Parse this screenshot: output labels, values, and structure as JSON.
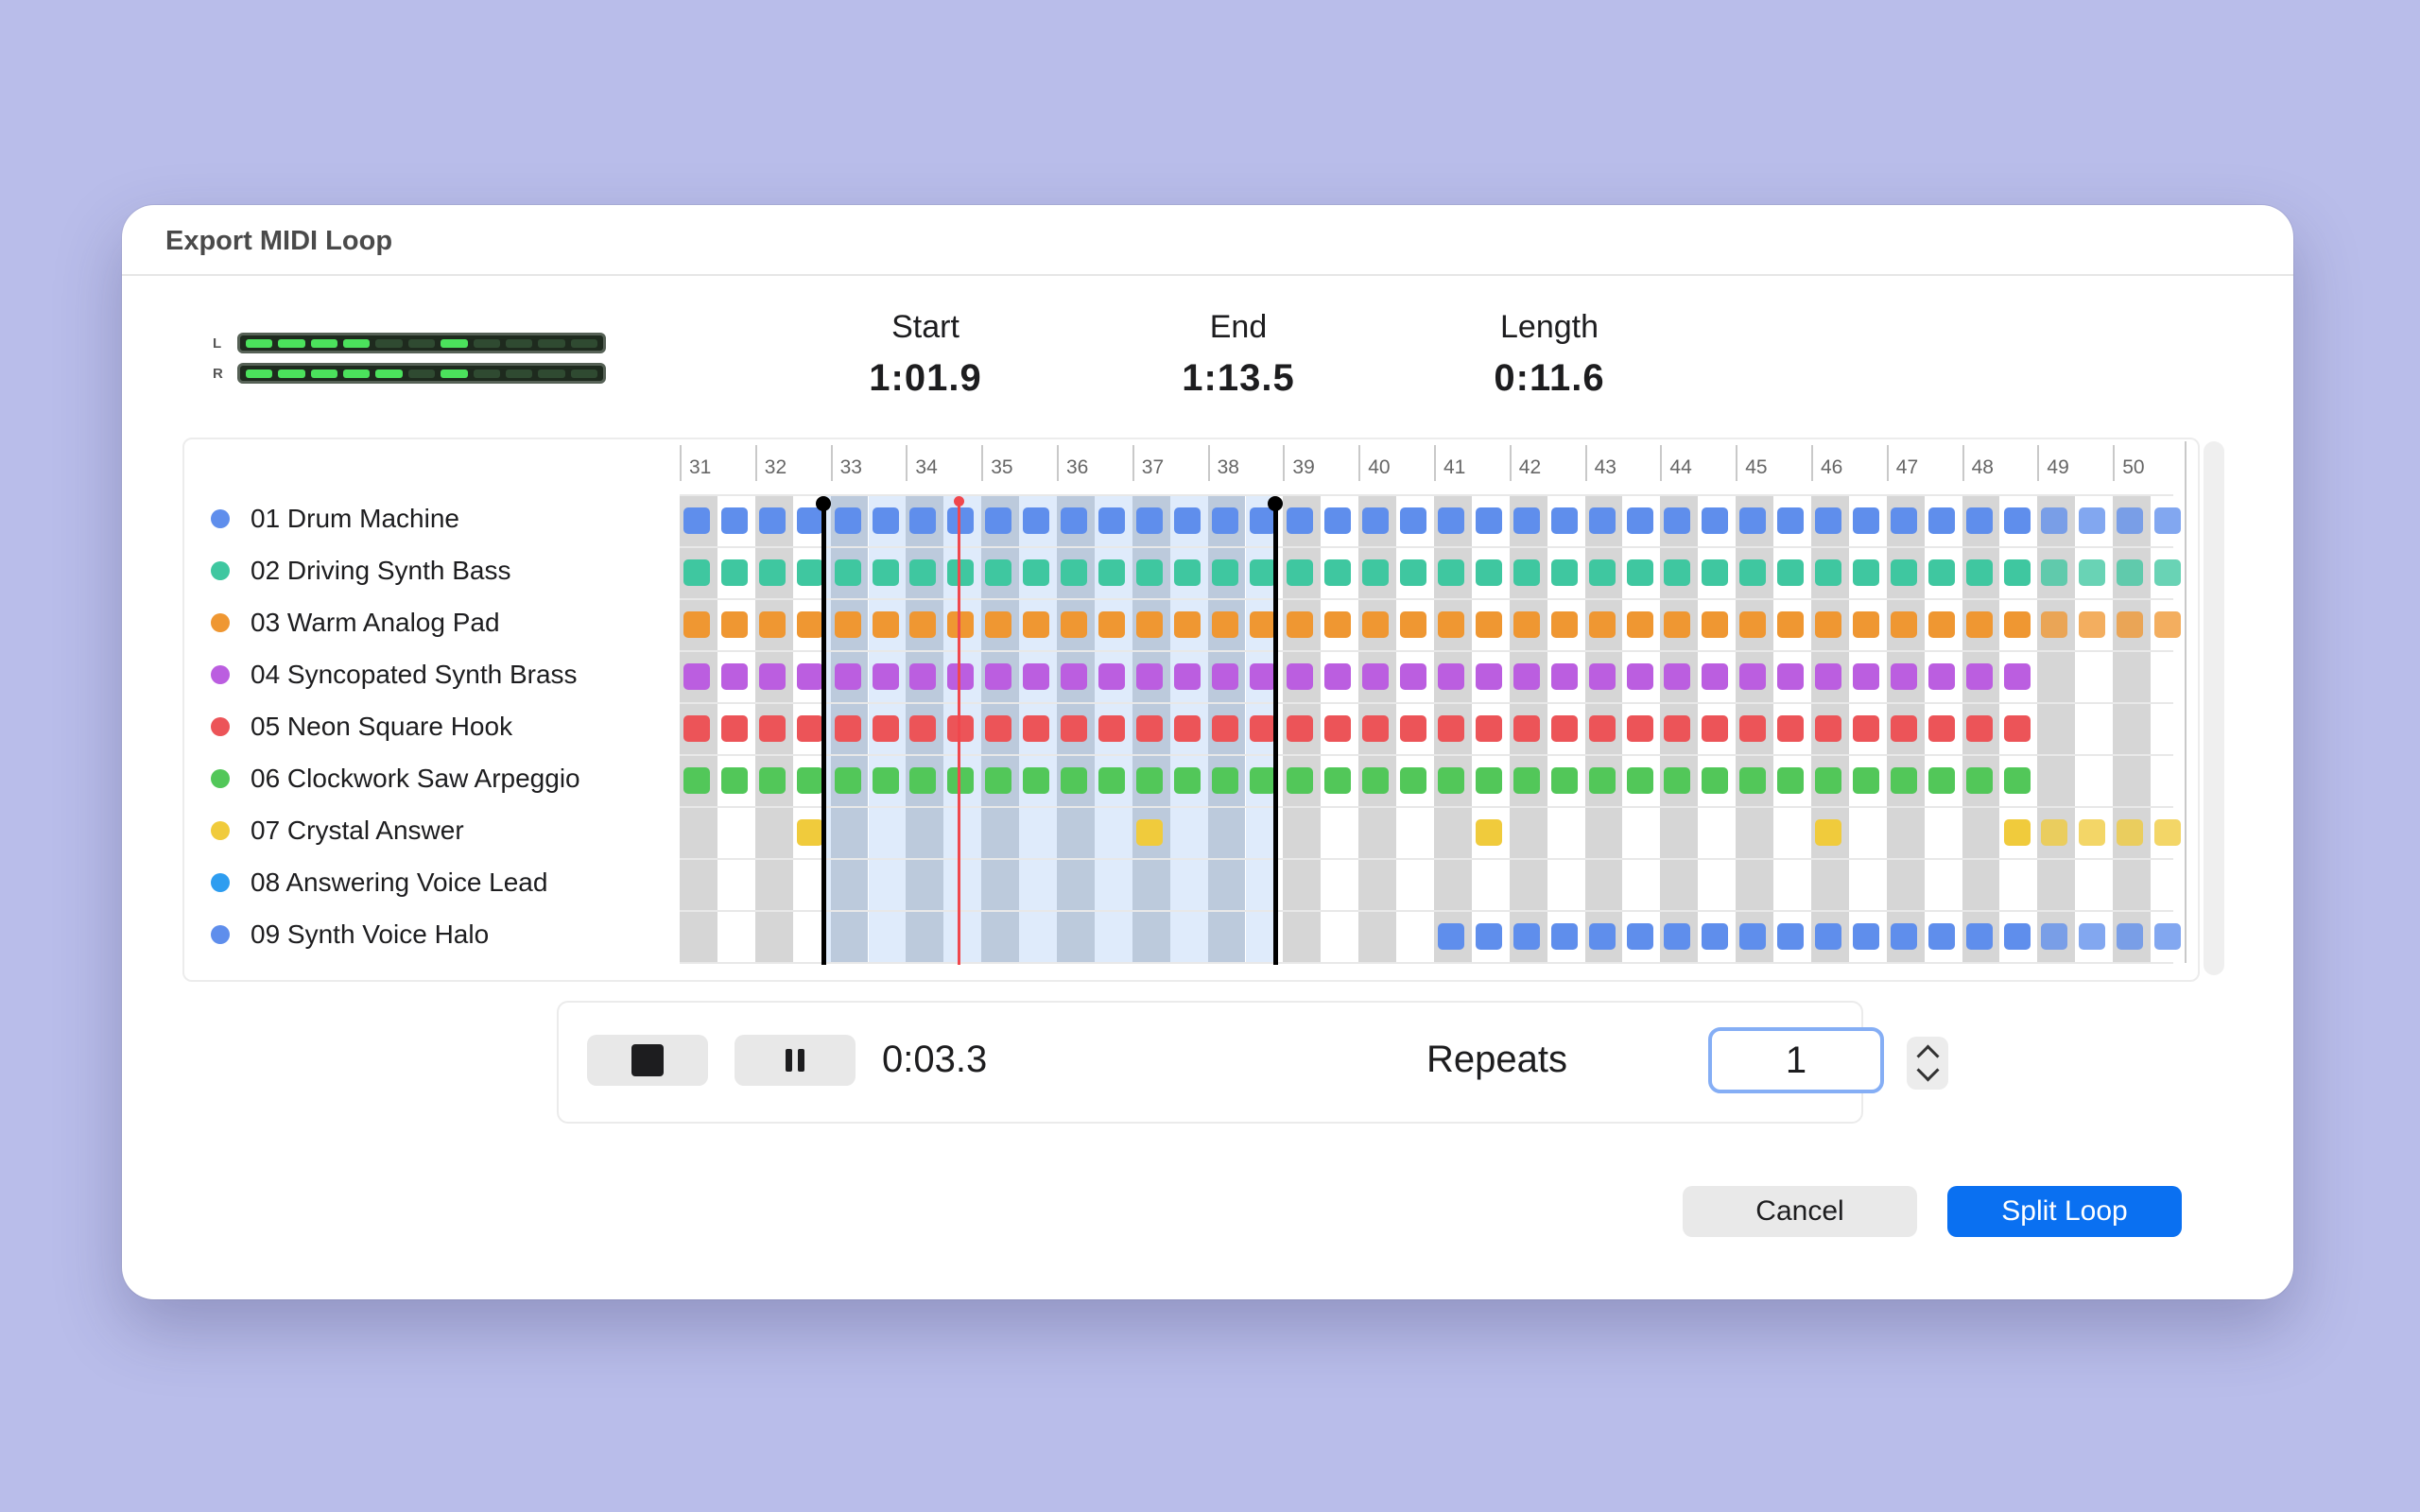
{
  "dialog": {
    "title": "Export MIDI Loop",
    "meters": {
      "left_label": "L",
      "right_label": "R",
      "left_level": [
        1,
        1,
        1,
        1,
        0,
        0,
        1,
        0,
        0,
        0,
        0
      ],
      "right_level": [
        1,
        1,
        1,
        1,
        1,
        0,
        1,
        0,
        0,
        0,
        0
      ]
    },
    "stats": {
      "start_label": "Start",
      "start_value": "1:01.9",
      "end_label": "End",
      "end_value": "1:13.5",
      "length_label": "Length",
      "length_value": "0:11.6"
    },
    "timeline": {
      "measures": [
        "31",
        "32",
        "33",
        "34",
        "35",
        "36",
        "37",
        "38",
        "39",
        "40",
        "41",
        "42",
        "43",
        "44",
        "45",
        "46",
        "47",
        "48",
        "49",
        "50"
      ],
      "selection": {
        "start_measure": 32.9,
        "end_measure": 38.9
      },
      "playhead_measure": 34.7,
      "tracks": [
        {
          "name": "01 Drum Machine",
          "color": "#5f8eec",
          "pattern": "1111111111111111111111111111111111111111"
        },
        {
          "name": "02 Driving Synth Bass",
          "color": "#3fc7a0",
          "pattern": "1111111111111111111111111111111111111111"
        },
        {
          "name": "03 Warm Analog Pad",
          "color": "#ef9732",
          "pattern": "1111111111111111111111111111111111111111"
        },
        {
          "name": "04 Syncopated Synth Brass",
          "color": "#bb5ee0",
          "pattern": "1111111111111111111111111111111111110000"
        },
        {
          "name": "05 Neon Square Hook",
          "color": "#ec5458",
          "pattern": "1111111111111111111111111111111111110000"
        },
        {
          "name": "06 Clockwork Saw Arpeggio",
          "color": "#52c759",
          "pattern": "1111111111111111111111111111111111110000"
        },
        {
          "name": "07 Crystal Answer",
          "color": "#f0cb3c",
          "pattern": "0001000000001000000001000000001000011111"
        },
        {
          "name": "08 Answering Voice Lead",
          "color": "#2e9df0",
          "pattern": "0000000000000000000000000000000000000000"
        },
        {
          "name": "09 Synth Voice Halo",
          "color": "#5f8eec",
          "pattern": "0000000000000000000011111111111111111111"
        }
      ]
    },
    "transport": {
      "stop_icon": "stop-icon",
      "pause_icon": "pause-icon",
      "timecode": "0:03.3",
      "repeats_label": "Repeats",
      "repeats_value": "1"
    },
    "buttons": {
      "cancel": "Cancel",
      "primary": "Split Loop",
      "primary_color": "#0a70f1"
    }
  }
}
